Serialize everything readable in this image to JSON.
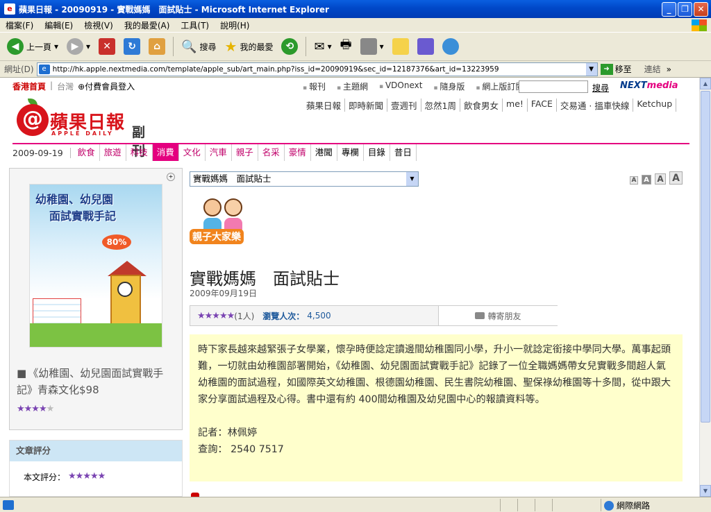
{
  "window": {
    "title": "蘋果日報 - 20090919 - 實戰媽媽　面試貼士 - Microsoft Internet Explorer",
    "controls": [
      "minimize",
      "maximize",
      "close"
    ]
  },
  "menu": [
    "檔案(F)",
    "編輯(E)",
    "檢視(V)",
    "我的最愛(A)",
    "工具(T)",
    "說明(H)"
  ],
  "toolbar": {
    "back": "上一頁",
    "search": "搜尋",
    "favorites": "我的最愛"
  },
  "address": {
    "label": "網址(D)",
    "url": "http://hk.apple.nextmedia.com/template/apple_sub/art_main.php?iss_id=20090919&sec_id=12187376&art_id=13223959",
    "go": "移至",
    "links": "連結"
  },
  "site": {
    "top_left": {
      "hk": "香港首頁",
      "tw": "台灣",
      "member": "付費會員登入"
    },
    "top_nav": [
      "報刊",
      "主題網",
      "VDOnext",
      "隨身版",
      "網上版訂閱"
    ],
    "search_btn": "搜尋",
    "brand_next": "NEXT",
    "brand_media": "media",
    "sublinks": [
      "蘋果日報",
      "即時新聞",
      "壹週刊",
      "忽然1周",
      "飲食男女",
      "me!",
      "FACE",
      "交易通 · 搵車快線",
      "Ketchup"
    ],
    "logo": {
      "mark": "@",
      "name": "蘋果日報",
      "en": "APPLE DAILY",
      "section": "副刊"
    },
    "date": "2009-09-19",
    "sections": [
      {
        "label": "飲食",
        "state": "normal"
      },
      {
        "label": "旅遊",
        "state": "normal"
      },
      {
        "label": "科技",
        "state": "normal"
      },
      {
        "label": "消費",
        "state": "active"
      },
      {
        "label": "文化",
        "state": "normal"
      },
      {
        "label": "汽車",
        "state": "normal"
      },
      {
        "label": "親子",
        "state": "normal"
      },
      {
        "label": "名采",
        "state": "normal"
      },
      {
        "label": "豪情",
        "state": "normal"
      },
      {
        "label": "港聞",
        "state": "dark"
      },
      {
        "label": "專欄",
        "state": "dark"
      },
      {
        "label": "目錄",
        "state": "dark"
      },
      {
        "label": "昔日",
        "state": "dark"
      }
    ]
  },
  "sidebar": {
    "book": {
      "cover_title_1": "幼稚園、幼兒園",
      "cover_title_2": "面試實戰手記",
      "cover_pct": "80%",
      "caption": "《幼稚園、幼兒園面試實戰手記》青森文化$98",
      "rating_filled": 4,
      "rating_total": 5
    },
    "rating_box": {
      "title": "文章評分",
      "label": "本文評分："
    }
  },
  "article": {
    "category": "實戰媽媽　面試貼士",
    "font_sizes": [
      "A",
      "A",
      "A",
      "A"
    ],
    "badge_label": "親子大家樂",
    "title": "實戰媽媽　面試貼士",
    "date": "2009年09月19日",
    "rating_count": "(1人)",
    "views_label": "瀏覽人次：",
    "views_value": "4,500",
    "forward": "轉寄朋友",
    "body": "時下家長越來越緊張子女學業，懷孕時便諗定讀邊間幼稚園同小學，升小一就諗定銜接中學同大學。萬事起頭難，一切就由幼稚園部署開始，《幼稚園、幼兒園面試實戰手記》記錄了一位全職媽媽帶女兒實戰多間超人氣幼稚園的面試過程，如國際英文幼稚園、根德園幼稚園、民生書院幼稚園、聖保祿幼稚園等十多間，從中跟大家分享面試過程及心得。書中還有約 400間幼稚園及幼兒園中心的報讀資料等。",
    "reporter": "記者：林佩婷",
    "enquiry": "查詢： 2540 7517"
  },
  "status": {
    "zone": "網際網路"
  }
}
